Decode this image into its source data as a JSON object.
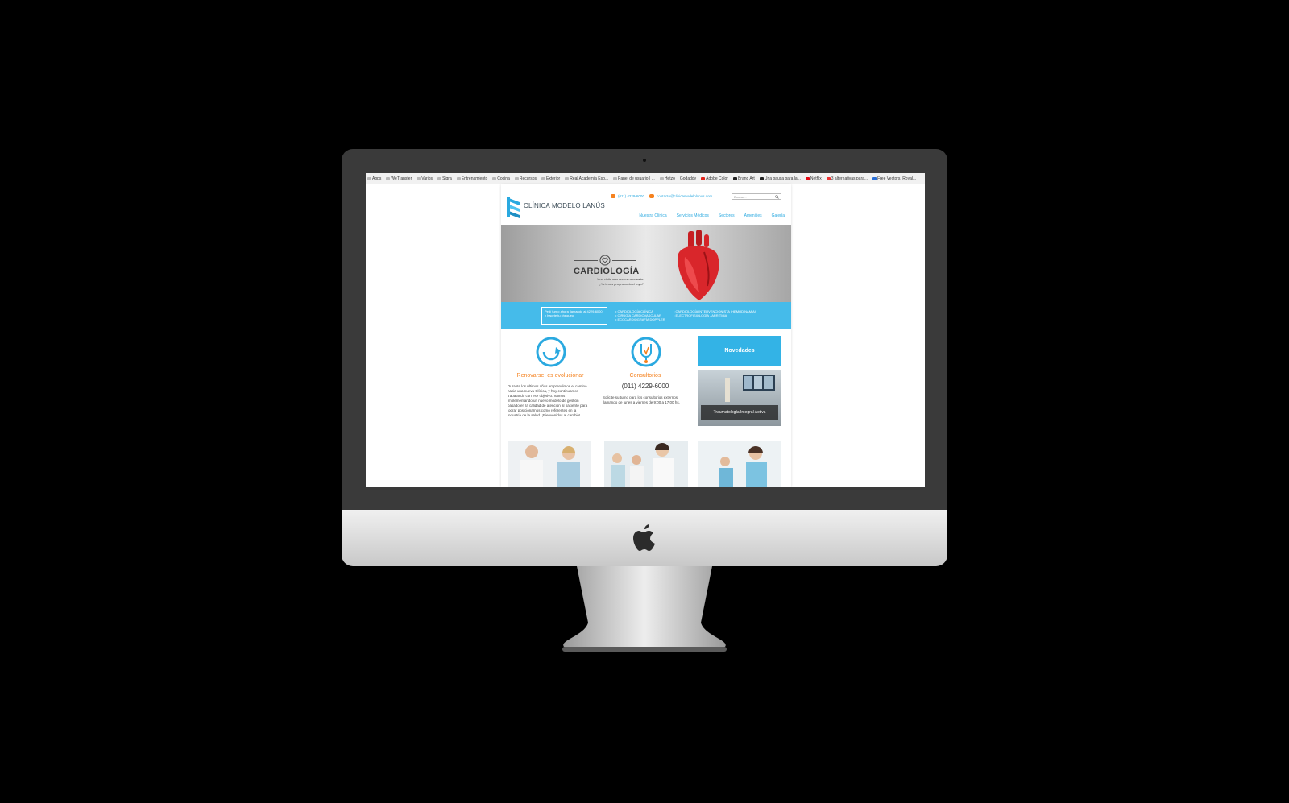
{
  "browser": {
    "bookmarks": [
      "Apps",
      "WeTransfer",
      "Varios",
      "Sigra",
      "Entrenamiento",
      "Cocina",
      "Recursos",
      "Exterior",
      "Real Academia Esp...",
      "Panel de usuario | ...",
      "Hetzo",
      "Godaddy",
      "Adobe Color",
      "Brand Art",
      "Una pausa para la...",
      "Netflix",
      "3 alternativas para...",
      "Free Vectors, Royal..."
    ]
  },
  "site": {
    "logo": "CLÍNICA MODELO LANÚS",
    "phone": "(011) 4229-6000",
    "email": "contacto@clinicamodelolanus.com",
    "search_placeholder": "Buscar...",
    "nav": [
      "Nuestra Clínica",
      "Servicios Médicos",
      "Sectores",
      "Amenities",
      "Galería"
    ],
    "hero": {
      "title": "CARDIOLOGÍA",
      "subtitle_1": "Una visita una vez es necesaria.",
      "subtitle_2": "¿Ya tenés programado el tuyo?"
    },
    "band": {
      "box_text": "Pedí turno ahora llamando al 4229-6000 y hacete tu chequeo",
      "list_left": [
        "• CARDIOLOGÍA CLÍNICA",
        "• CIRUGÍA CARDIOVASCULAR",
        "• ECOCARDIOGRAFÍA DOPPLER"
      ],
      "list_right": [
        "• CARDIOLOGÍA INTERVENCIONISTA (HEMODINAMIA)",
        "• ELECTROFISIOLOGÍA - ARRITMIA"
      ]
    },
    "col1": {
      "title": "Renovarse, es evolucionar",
      "text": "Durante los últimos años emprendimos el camino hacia una nueva Clínica, y hoy continuamos trabajando con ese objetivo. Vamos implementando un nuevo modelo de gestión basado en la calidad de atención al paciente para lograr posicionarnos como referentes en la industria de la salud. ¡Bienvenidos al cambio!"
    },
    "col2": {
      "title": "Consultorios",
      "phone": "(011) 4229-6000",
      "text": "Solicite su turno para los consultorios externos llamando de lunes a viernes de 9:00 a 17:00 hs."
    },
    "news": {
      "title": "Novedades",
      "caption": "Traumatología Integral Activa"
    }
  }
}
